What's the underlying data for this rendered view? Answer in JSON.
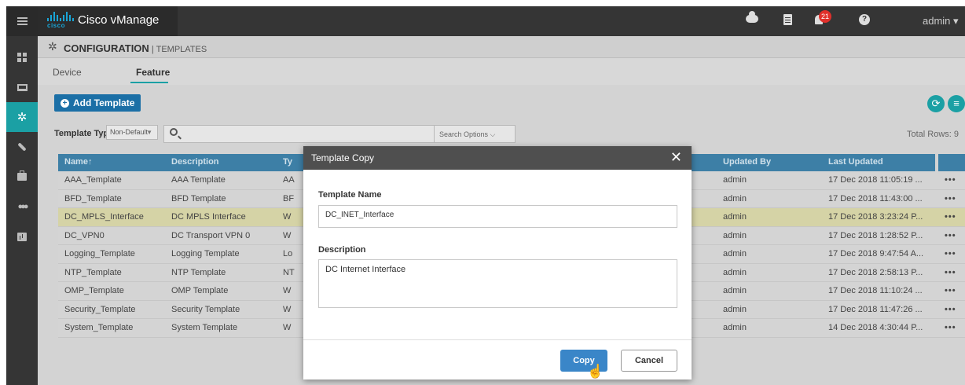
{
  "app": {
    "title": "Cisco vManage",
    "logo_text": "cisco"
  },
  "topbar": {
    "notifications": "21",
    "user": "admin ▾"
  },
  "header": {
    "section": "CONFIGURATION",
    "separator": " | ",
    "page": "TEMPLATES"
  },
  "tabs": [
    {
      "label": "Device"
    },
    {
      "label": "Feature"
    }
  ],
  "toolbar": {
    "add_label": "Add Template",
    "template_type_label": "Template Type",
    "template_type_value": "Non-Default",
    "search_options": "Search Options ⌵",
    "total_rows": "Total Rows: 9"
  },
  "table": {
    "headers": {
      "name": "Name↑",
      "description": "Description",
      "type": "Ty",
      "updated_by": "Updated By",
      "last_updated": "Last Updated"
    },
    "rows": [
      {
        "name": "AAA_Template",
        "description": "AAA Template",
        "type": "AA",
        "updated_by": "admin",
        "last_updated": "17 Dec 2018 11:05:19 ...",
        "more": "•••"
      },
      {
        "name": "BFD_Template",
        "description": "BFD Template",
        "type": "BF",
        "updated_by": "admin",
        "last_updated": "17 Dec 2018 11:43:00 ...",
        "more": "•••"
      },
      {
        "name": "DC_MPLS_Interface",
        "description": "DC MPLS Interface",
        "type": "W",
        "updated_by": "admin",
        "last_updated": "17 Dec 2018 3:23:24 P...",
        "more": "•••"
      },
      {
        "name": "DC_VPN0",
        "description": "DC Transport VPN 0",
        "type": "W",
        "updated_by": "admin",
        "last_updated": "17 Dec 2018 1:28:52 P...",
        "more": "•••"
      },
      {
        "name": "Logging_Template",
        "description": "Logging Template",
        "type": "Lo",
        "updated_by": "admin",
        "last_updated": "17 Dec 2018 9:47:54 A...",
        "more": "•••"
      },
      {
        "name": "NTP_Template",
        "description": "NTP Template",
        "type": "NT",
        "updated_by": "admin",
        "last_updated": "17 Dec 2018 2:58:13 P...",
        "more": "•••"
      },
      {
        "name": "OMP_Template",
        "description": "OMP Template",
        "type": "W",
        "updated_by": "admin",
        "last_updated": "17 Dec 2018 11:10:24 ...",
        "more": "•••"
      },
      {
        "name": "Security_Template",
        "description": "Security Template",
        "type": "W",
        "updated_by": "admin",
        "last_updated": "17 Dec 2018 11:47:26 ...",
        "more": "•••"
      },
      {
        "name": "System_Template",
        "description": "System Template",
        "type": "W",
        "updated_by": "admin",
        "last_updated": "14 Dec 2018 4:30:44 P...",
        "more": "•••"
      }
    ]
  },
  "modal": {
    "title": "Template Copy",
    "name_label": "Template Name",
    "name_value": "DC_INET_Interface",
    "desc_label": "Description",
    "desc_value": "DC Internet Interface",
    "copy_label": "Copy",
    "cancel_label": "Cancel"
  },
  "colors": {
    "accent": "#1ba0a4",
    "table_header": "#3d7fa6",
    "primary_button": "#3a86c8",
    "highlight_row": "#d5d3a6"
  },
  "icons": [
    "menu-icon",
    "cloud-icon",
    "clipboard-icon",
    "bell-icon",
    "help-icon",
    "dashboard-icon",
    "monitor-icon",
    "gear-icon",
    "wrench-icon",
    "briefcase-icon",
    "users-icon",
    "analytics-icon",
    "refresh-icon",
    "list-icon",
    "search-icon",
    "close-icon",
    "hand-pointer-icon"
  ]
}
